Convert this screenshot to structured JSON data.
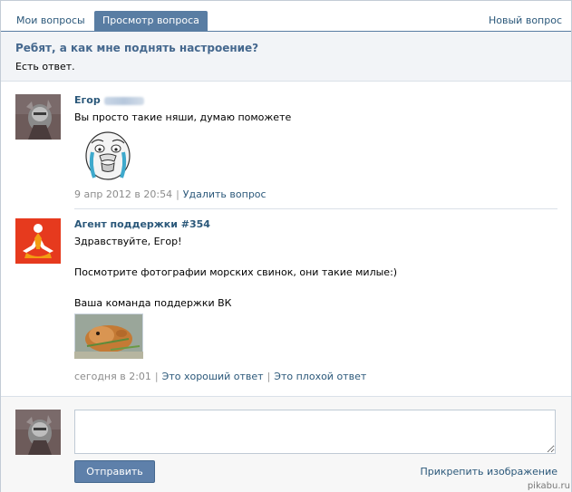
{
  "tabs": {
    "my_questions": "Мои вопросы",
    "view_question": "Просмотр вопроса",
    "new_question": "Новый вопрос"
  },
  "question": {
    "title": "Ребят, а как мне поднять настроение?",
    "status": "Есть ответ."
  },
  "posts": [
    {
      "author": "Егор",
      "text": "Вы просто такие няши, думаю поможете",
      "date": "9 апр 2012 в 20:54",
      "action": "Удалить вопрос"
    },
    {
      "author": "Агент поддержки #354",
      "greeting": "Здравствуйте, Егор!",
      "body": "Посмотрите фотографии морских свинок, они такие милые:)",
      "signature": "Ваша команда поддержки ВК",
      "date": "сегодня в 2:01",
      "good": "Это хороший ответ",
      "bad": "Это плохой ответ"
    }
  ],
  "reply": {
    "input_value": "",
    "send_label": "Отправить",
    "attach_label": "Прикрепить изображение"
  },
  "watermark": "pikabu.ru",
  "colors": {
    "accent": "#597da3",
    "link": "#2b587a",
    "button": "#5e80aa"
  }
}
